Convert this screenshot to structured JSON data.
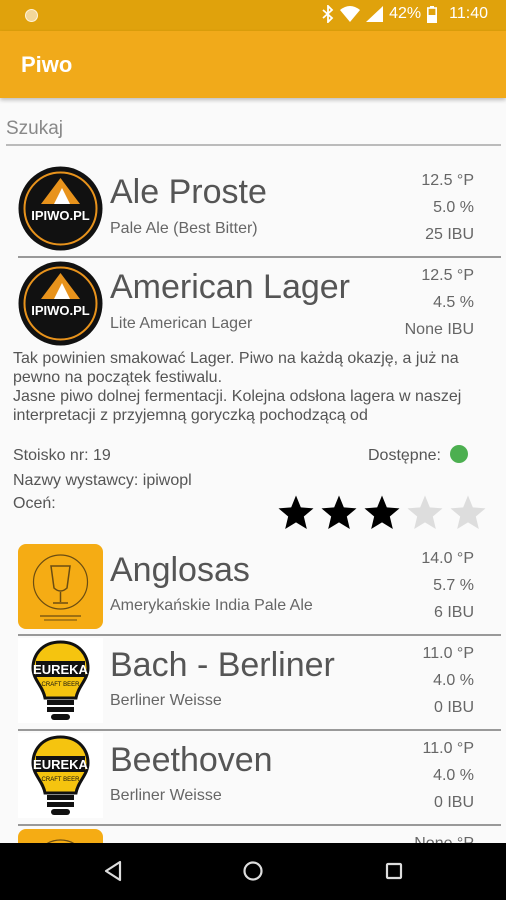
{
  "status_bar": {
    "battery": "42%",
    "time": "11:40"
  },
  "app_bar": {
    "title": "Piwo"
  },
  "search": {
    "placeholder": "Szukaj"
  },
  "beers": [
    {
      "name": "Ale Proste",
      "style": "Pale Ale (Best Bitter)",
      "plato": "12.5 °P",
      "abv": "5.0 %",
      "ibu": "25 IBU",
      "logo": "ipiwo-logo"
    },
    {
      "name": "American Lager",
      "style": "Lite American Lager",
      "plato": "12.5 °P",
      "abv": "4.5 %",
      "ibu": "None IBU",
      "logo": "ipiwo-logo"
    },
    {
      "name": "Anglosas",
      "style": "Amerykańskie India Pale Ale",
      "plato": "14.0 °P",
      "abv": "5.7 %",
      "ibu": "6 IBU",
      "logo": "browar-logo"
    },
    {
      "name": "Bach - Berliner",
      "style": "Berliner Weisse",
      "plato": "11.0 °P",
      "abv": "4.0 %",
      "ibu": "0 IBU",
      "logo": "eureka-logo"
    },
    {
      "name": "Beethoven",
      "style": "Berliner Weisse",
      "plato": "11.0 °P",
      "abv": "4.0 %",
      "ibu": "0 IBU",
      "logo": "eureka-logo"
    },
    {
      "name": "",
      "style": "",
      "plato": "None °P",
      "abv": "",
      "ibu": "",
      "logo": "browar-logo"
    }
  ],
  "logo_text": {
    "ipiwo": "IPIWO.PL",
    "eureka": "EUREKA",
    "eureka_sub": "CRAFT BEER"
  },
  "details": {
    "description": "Tak powinien smakować Lager. Piwo na każdą okazję, a już na pewno na początek festiwalu.\nJasne piwo dolnej fermentacji. Kolejna odsłona lagera w naszej interpretacji z przyjemną goryczką pochodzącą od",
    "stand": "Stoisko nr: 19",
    "exhibitor": "Nazwy wystawcy: ipiwopl",
    "rate_label": "Oceń:",
    "available_label": "Dostępne:",
    "available_color": "#4caf50",
    "rating": 3,
    "rating_max": 5
  },
  "colors": {
    "status_bar": "#e0a20c",
    "app_bar": "#f1aa1a",
    "star_on": "#000000",
    "star_off": "#dddddd"
  }
}
